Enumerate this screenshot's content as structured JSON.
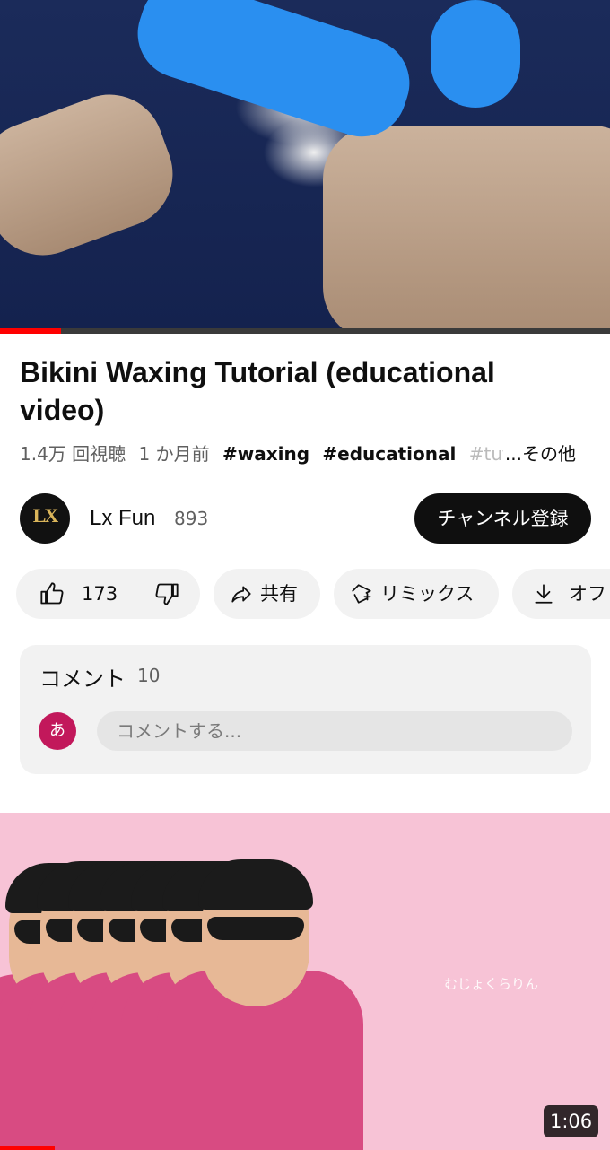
{
  "video": {
    "progress_percent": 10
  },
  "title": "Bikini Waxing Tutorial (educational video)",
  "meta": {
    "views": "1.4万 回視聴",
    "age": "1 か月前",
    "hashtags": [
      "#waxing",
      "#educational",
      "#tuto"
    ],
    "more_label": "...その他"
  },
  "channel": {
    "avatar_text": "LX",
    "name": "Lx Fun",
    "subscribers": "893",
    "subscribe_label": "チャンネル登録"
  },
  "actions": {
    "like_count": "173",
    "share_label": "共有",
    "remix_label": "リミックス",
    "download_label": "オフ"
  },
  "comments": {
    "title": "コメント",
    "count": "10",
    "user_initial": "あ",
    "placeholder": "コメントする..."
  },
  "next_video": {
    "watermark": "むじょくらりん",
    "duration": "1:06",
    "progress_percent": 9
  },
  "icons": [
    "thumbs-up-icon",
    "thumbs-down-icon",
    "share-icon",
    "remix-icon",
    "download-icon"
  ],
  "colors": {
    "accent": "#ff0000",
    "subscribe_bg": "#0f0f0f",
    "user_avatar": "#c2185b",
    "pill_bg": "#f2f2f2"
  }
}
